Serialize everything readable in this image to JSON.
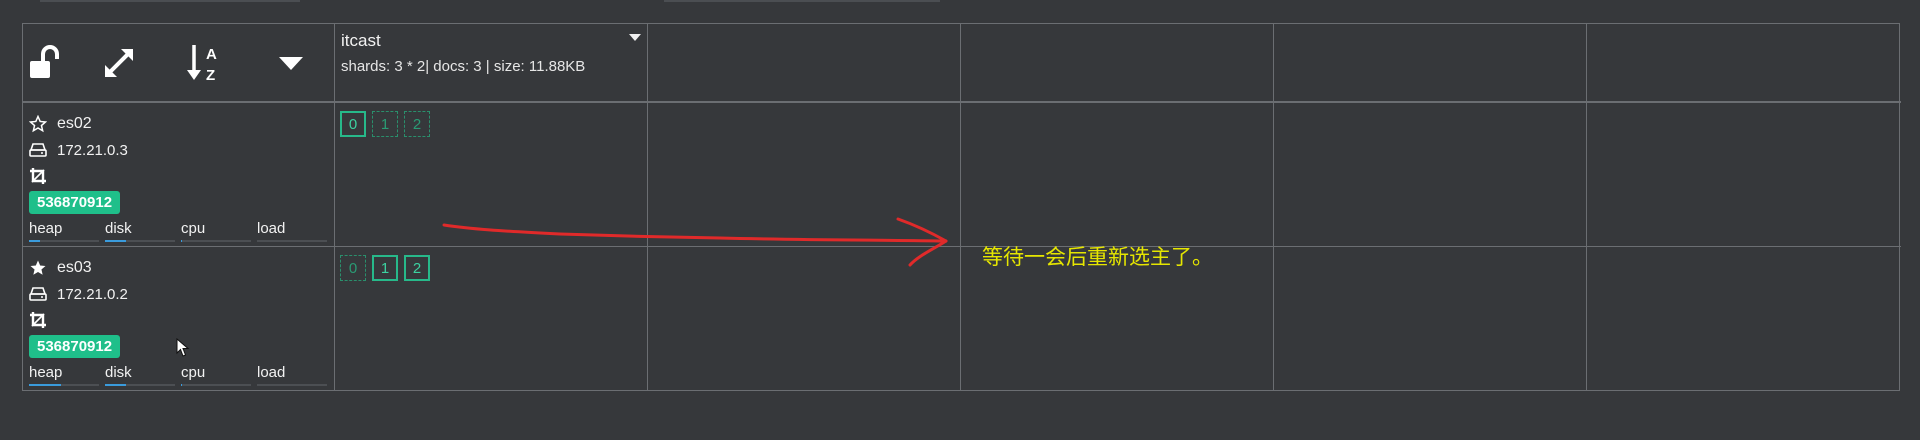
{
  "toolbar": {
    "icons": [
      "unlock-icon",
      "expand-icon",
      "sort-alpha-icon",
      "caret-down-icon"
    ]
  },
  "index": {
    "name": "itcast",
    "stats": "shards: 3 * 2| docs: 3 | size: 11.88KB"
  },
  "nodes": [
    {
      "name": "es02",
      "ip": "172.21.0.3",
      "badge": "536870912",
      "master": false,
      "metrics": [
        {
          "label": "heap",
          "value": 0.15
        },
        {
          "label": "disk",
          "value": 0.3
        },
        {
          "label": "cpu",
          "value": 0.02
        },
        {
          "label": "load",
          "value": 0.0
        }
      ],
      "shards": [
        {
          "label": "0",
          "state": "primary"
        },
        {
          "label": "1",
          "state": "replica"
        },
        {
          "label": "2",
          "state": "replica"
        }
      ]
    },
    {
      "name": "es03",
      "ip": "172.21.0.2",
      "badge": "536870912",
      "master": true,
      "metrics": [
        {
          "label": "heap",
          "value": 0.45
        },
        {
          "label": "disk",
          "value": 0.3
        },
        {
          "label": "cpu",
          "value": 0.02
        },
        {
          "label": "load",
          "value": 0.0
        }
      ],
      "shards": [
        {
          "label": "0",
          "state": "replica"
        },
        {
          "label": "1",
          "state": "primary"
        },
        {
          "label": "2",
          "state": "primary"
        }
      ]
    }
  ],
  "annotation": {
    "text": "等待一会后重新选主了。",
    "color": "#e6e600",
    "arrow_color": "#e02a2a"
  },
  "colors": {
    "background": "#36383b",
    "grid_line": "#6b6e72",
    "badge": "#1fbf8a",
    "shard": "#27b98a",
    "metric_fill": "#3a9bdc"
  }
}
